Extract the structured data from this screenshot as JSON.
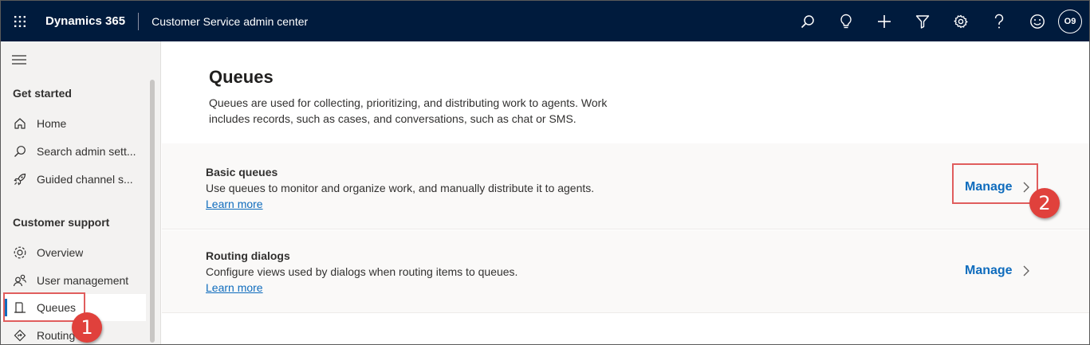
{
  "header": {
    "brand": "Dynamics 365",
    "app_name": "Customer Service admin center",
    "icons": [
      "waffle-icon",
      "search-icon",
      "lightbulb-icon",
      "plus-icon",
      "filter-icon",
      "settings-icon",
      "help-icon",
      "smiley-icon"
    ],
    "avatar_initials": "O9"
  },
  "sidebar": {
    "sections": [
      {
        "title": "Get started",
        "items": [
          {
            "label": "Home",
            "icon": "home-icon"
          },
          {
            "label": "Search admin sett...",
            "icon": "search-icon"
          },
          {
            "label": "Guided channel s...",
            "icon": "rocket-icon"
          }
        ]
      },
      {
        "title": "Customer support",
        "items": [
          {
            "label": "Overview",
            "icon": "overview-icon"
          },
          {
            "label": "User management",
            "icon": "users-icon"
          },
          {
            "label": "Queues",
            "icon": "queue-icon",
            "active": true
          },
          {
            "label": "Routing",
            "icon": "routing-icon"
          }
        ]
      }
    ]
  },
  "page": {
    "title": "Queues",
    "description": "Queues are used for collecting, prioritizing, and distributing work to agents. Work includes records, such as cases, and conversations, such as chat or SMS."
  },
  "cards": [
    {
      "title": "Basic queues",
      "description": "Use queues to monitor and organize work, and manually distribute it to agents.",
      "link": "Learn more",
      "action": "Manage"
    },
    {
      "title": "Routing dialogs",
      "description": "Configure views used by dialogs when routing items to queues.",
      "link": "Learn more",
      "action": "Manage"
    }
  ],
  "annotations": {
    "step1": "1",
    "step2": "2",
    "color": "#e0413c"
  },
  "colors": {
    "topbar": "#001b3d",
    "accent": "#0f6cbd"
  }
}
